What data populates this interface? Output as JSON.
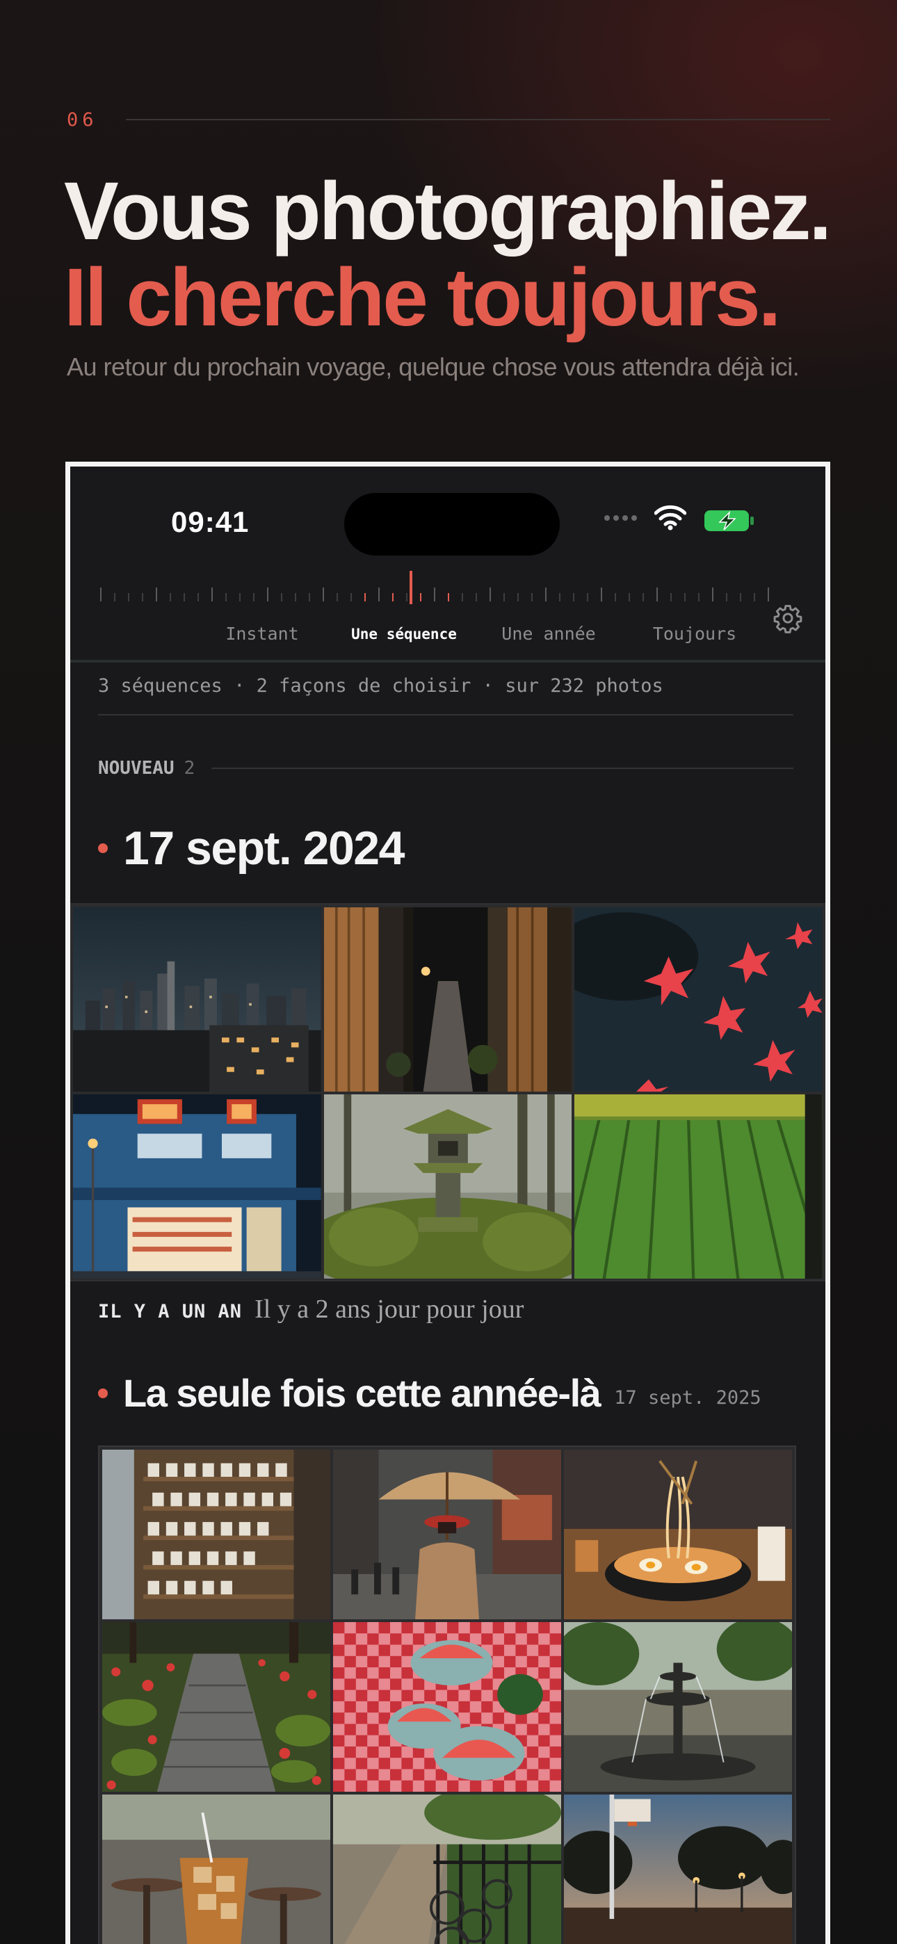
{
  "section": {
    "number": "06"
  },
  "headline": {
    "line1": "Vous photographiez.",
    "line2": "Il cherche toujours."
  },
  "subhead": "Au retour du prochain voyage, quelque chose vous attendra déjà ici.",
  "colors": {
    "accent": "#e35c4e",
    "background": "#141212",
    "phone_screen": "#19191b",
    "battery": "#34c759"
  },
  "phone": {
    "status_bar": {
      "time": "09:41",
      "wifi_icon": "wifi-icon",
      "battery_icon": "battery-charging-icon"
    },
    "tabs": [
      {
        "label": "Instant",
        "active": false
      },
      {
        "label": "Une séquence",
        "active": true
      },
      {
        "label": "Une année",
        "active": false
      },
      {
        "label": "Toujours",
        "active": false
      }
    ],
    "settings_icon": "gear-icon",
    "summary": "3 séquences · 2 façons de choisir · sur 232 photos",
    "new_section": {
      "label": "NOUVEAU",
      "count": "2"
    },
    "sequence1": {
      "title": "17 sept. 2024",
      "photos": [
        "city-skyline-night",
        "alley-curtains",
        "red-maple-leaves-water",
        "convenience-store-night",
        "moss-stone-lantern",
        "rice-paddies"
      ]
    },
    "memory": {
      "tag": "IL Y A UN AN",
      "text": "Il y a 2 ans jour pour jour"
    },
    "sequence2": {
      "title": "La seule fois cette année-là",
      "date": "17 sept. 2025",
      "photos": [
        "ceramic-shelves",
        "umbrella-street",
        "ramen-bowl",
        "moss-path-red-leaves",
        "watermelon-picnic",
        "park-fountain",
        "iced-tea-cafe",
        "bikes-railing",
        "basketball-court-dusk"
      ]
    }
  }
}
